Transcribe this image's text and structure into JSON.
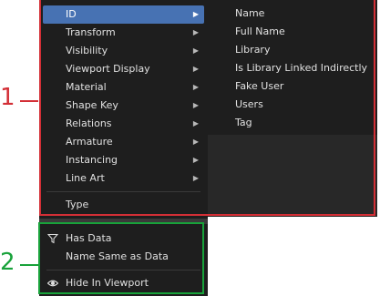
{
  "object_menu": {
    "items": [
      {
        "label": "ID",
        "has_submenu": true,
        "highlighted": true
      },
      {
        "label": "Transform",
        "has_submenu": true
      },
      {
        "label": "Visibility",
        "has_submenu": true
      },
      {
        "label": "Viewport Display",
        "has_submenu": true
      },
      {
        "label": "Material",
        "has_submenu": true
      },
      {
        "label": "Shape Key",
        "has_submenu": true
      },
      {
        "label": "Relations",
        "has_submenu": true
      },
      {
        "label": "Armature",
        "has_submenu": true
      },
      {
        "label": "Instancing",
        "has_submenu": true
      },
      {
        "label": "Line Art",
        "has_submenu": true
      },
      {
        "label": "Type",
        "has_submenu": false
      }
    ]
  },
  "id_submenu": {
    "items": [
      "Name",
      "Full Name",
      "Library",
      "Is Library Linked Indirectly",
      "Fake User",
      "Users",
      "Tag"
    ]
  },
  "filter_menu": {
    "items": [
      {
        "label": "Has Data",
        "icon": "filter-icon"
      },
      {
        "label": "Name Same as Data",
        "icon": ""
      },
      {
        "label": "Hide In Viewport",
        "icon": "eye-icon"
      }
    ]
  },
  "callouts": {
    "one": "1",
    "two": "2",
    "one_color": "#d32f36",
    "two_color": "#18a23a"
  },
  "colors": {
    "menu_bg": "#1e1e1e",
    "highlight": "#4772b3",
    "text": "#e0e0e0"
  }
}
